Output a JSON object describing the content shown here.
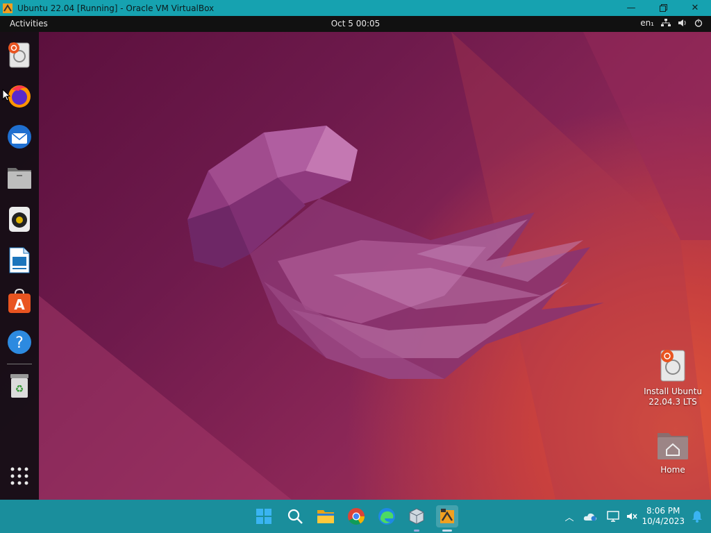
{
  "host_window": {
    "title": "Ubuntu 22.04 [Running] - Oracle VM VirtualBox",
    "controls": [
      "minimize-icon",
      "restore-icon",
      "close-icon"
    ]
  },
  "guest_topbar": {
    "activities": "Activities",
    "clock": "Oct 5  00:05",
    "input_lang": "en₁",
    "status_icons": [
      "network-icon",
      "volume-icon",
      "power-icon"
    ]
  },
  "dock": {
    "items": [
      {
        "name": "install-ubuntu",
        "icon": "installer-disk-icon"
      },
      {
        "name": "firefox",
        "icon": "firefox-icon"
      },
      {
        "name": "thunderbird",
        "icon": "thunderbird-icon"
      },
      {
        "name": "files",
        "icon": "folder-icon"
      },
      {
        "name": "rhythmbox",
        "icon": "speaker-icon"
      },
      {
        "name": "libreoffice-writer",
        "icon": "document-icon"
      },
      {
        "name": "ubuntu-software",
        "icon": "software-bag-icon"
      },
      {
        "name": "help",
        "icon": "help-icon"
      },
      {
        "name": "trash",
        "icon": "trash-icon"
      }
    ],
    "show_apps_icon": "grid-icon"
  },
  "desktop_icons": [
    {
      "label": "Install Ubuntu\n22.04.3 LTS",
      "icon": "installer-disk-icon"
    },
    {
      "label": "Home",
      "icon": "home-folder-icon"
    }
  ],
  "taskbar": {
    "apps": [
      "windows-start-icon",
      "search-icon",
      "file-explorer-icon",
      "chrome-icon",
      "edge-icon",
      "virtualbox-icon",
      "virtualbox-vm-icon"
    ],
    "tray_icons": [
      "chevron-up-icon",
      "onedrive-icon",
      "display-icon",
      "sound-muted-icon"
    ],
    "time": "8:06 PM",
    "date": "10/4/2023",
    "notification_icon": "bell-icon"
  },
  "colors": {
    "host_titlebar": "#16a2b0",
    "taskbar": "#1a8e9c",
    "topbar": "#111111",
    "wallpaper_primary": "#6e1a4c",
    "wallpaper_accent": "#e0553a"
  }
}
